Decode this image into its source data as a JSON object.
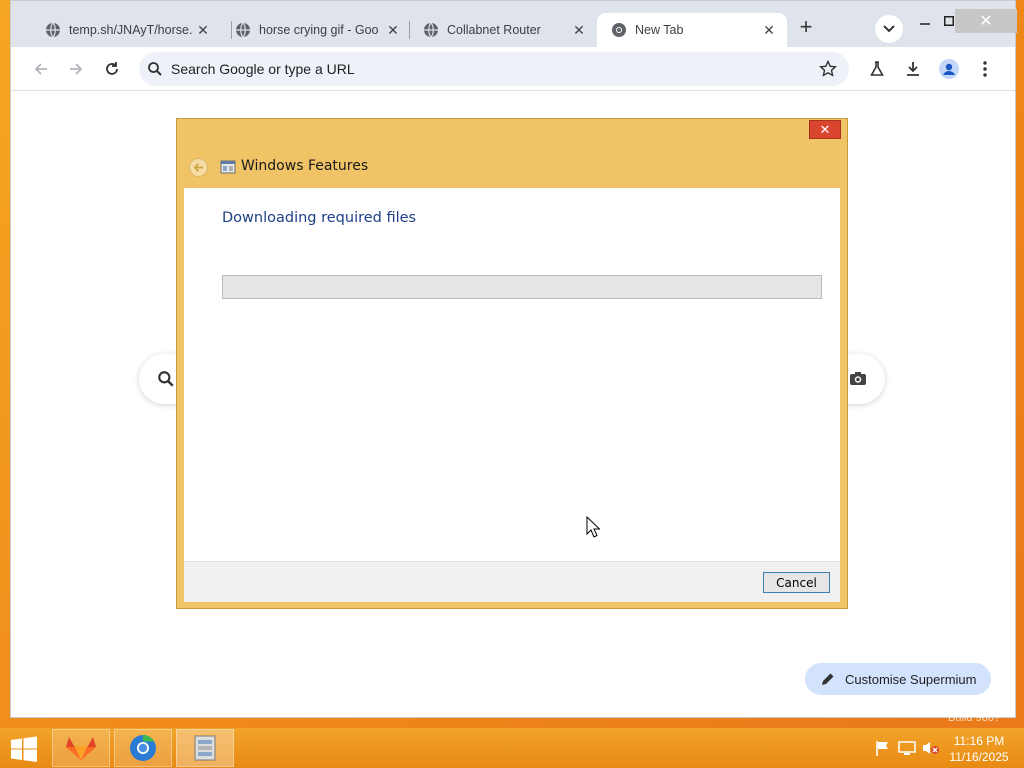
{
  "browser": {
    "tabs": [
      {
        "title": "temp.sh/JNAyT/horse.",
        "active": false
      },
      {
        "title": "horse crying gif - Goo",
        "active": false
      },
      {
        "title": "Collabnet Router",
        "active": false
      },
      {
        "title": "New Tab",
        "active": true
      }
    ],
    "newtab_label": "+",
    "tab_close_glyph": "✕",
    "window_close_glyph": "✕",
    "omnibox_placeholder": "Search Google or type a URL",
    "customise_label": "Customise Supermium"
  },
  "dialog": {
    "title": "Windows Features",
    "close_glyph": "✕",
    "heading": "Downloading required files",
    "progress": 0.0,
    "cancel_label": "Cancel"
  },
  "taskbar": {
    "time": "11:16 PM",
    "date": "11/16/2025",
    "build_text": "Build 960?"
  },
  "colors": {
    "accent": "#f0c466",
    "heading_blue": "#1e3f87",
    "taskbar": "#e88a14"
  },
  "icons": [
    "globe-icon",
    "chrome-icon",
    "back-arrow-icon",
    "forward-arrow-icon",
    "reload-icon",
    "search-icon",
    "star-icon",
    "flask-icon",
    "download-icon",
    "profile-icon",
    "kebab-menu-icon",
    "camera-icon",
    "pencil-icon",
    "windows-logo-icon"
  ]
}
